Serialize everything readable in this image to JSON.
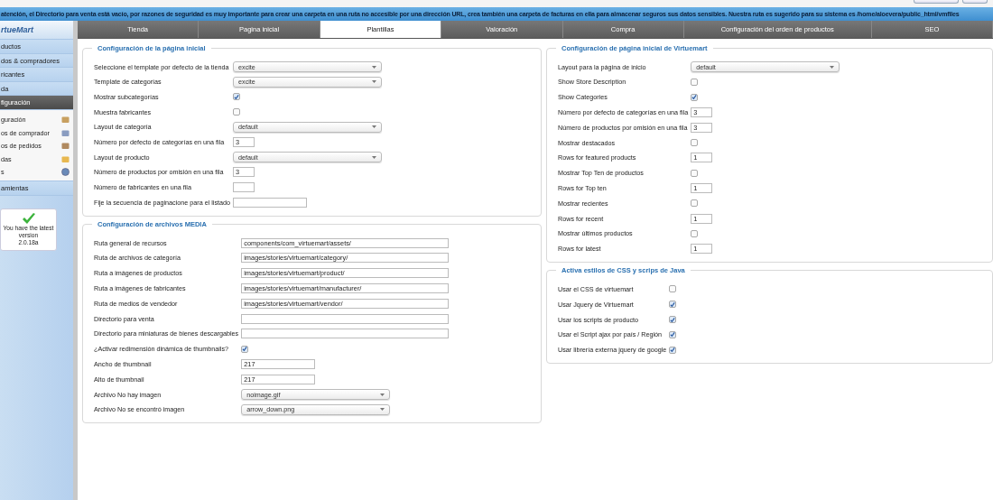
{
  "notice": "atención, el Directorio para venta está vacío, por razones de seguridad es muy importante para crear una carpeta en una ruta no accesible por una dirección URL, crea también una carpeta de facturas en ella para almacenar seguros sus datos sensibles. Nuestra ruta es sugerido para su sistema es /home/aloevera/public_html/vmfiles",
  "sidebar": {
    "logo": "rtueMart",
    "items": [
      {
        "label": "ductos",
        "selected": false
      },
      {
        "label": "dos & compradores",
        "selected": false
      },
      {
        "label": "ricantes",
        "selected": false
      },
      {
        "label": "da",
        "selected": false
      },
      {
        "label": "figuración",
        "selected": true,
        "children": [
          {
            "label": "guración"
          },
          {
            "label": "os de comprador"
          },
          {
            "label": "os de pedidos"
          },
          {
            "label": "das"
          },
          {
            "label": "s"
          }
        ]
      },
      {
        "label": "amientas",
        "selected": false
      }
    ],
    "version": {
      "message": "You have the latest version",
      "number": "2.0.18a"
    }
  },
  "tabs": [
    {
      "label": "Tienda",
      "selected": false
    },
    {
      "label": "Pagina inicial",
      "selected": false
    },
    {
      "label": "Plantillas",
      "selected": true
    },
    {
      "label": "Valoración",
      "selected": false
    },
    {
      "label": "Compra",
      "selected": false
    },
    {
      "label": "Configuración del orden de productos",
      "selected": false
    },
    {
      "label": "SEO",
      "selected": false
    }
  ],
  "columns": [
    [
      {
        "title": "Configuración de la página inicial",
        "fields": [
          {
            "label": "Seleccione el template por defecto de la tienda",
            "kind": "select",
            "value": "excite"
          },
          {
            "label": "Template de categorías",
            "kind": "select",
            "value": "excite"
          },
          {
            "label": "Mostrar subcategorías",
            "kind": "checkbox",
            "checked": true
          },
          {
            "label": "Muestra fabricantes",
            "kind": "checkbox",
            "checked": false
          },
          {
            "label": "Layout de categoría",
            "kind": "select",
            "value": "default"
          },
          {
            "label": "Número por defecto de categorías en una fila",
            "kind": "number",
            "value": "3"
          },
          {
            "label": "Layout de producto",
            "kind": "select",
            "value": "default"
          },
          {
            "label": "Número de productos por omisión en una fila",
            "kind": "number",
            "value": "3"
          },
          {
            "label": "Número de fabricantes en una fila",
            "kind": "number"
          },
          {
            "label": "Fije la secuencia de paginacione para el listado",
            "kind": "text"
          }
        ]
      },
      {
        "title": "Configuración de archivos MEDIA",
        "fields": [
          {
            "label": "Ruta general de recursos",
            "kind": "path",
            "value": "components/com_virtuemart/assets/"
          },
          {
            "label": "Ruta de archivos de categoría",
            "kind": "path",
            "value": "images/stories/virtuemart/category/"
          },
          {
            "label": "Ruta a imágenes de productos",
            "kind": "path",
            "value": "images/stories/virtuemart/product/"
          },
          {
            "label": "Ruta a imágenes de fabricantes",
            "kind": "path",
            "value": "images/stories/virtuemart/manufacturer/"
          },
          {
            "label": "Ruta de medios de vendedor",
            "kind": "path",
            "value": "images/stories/virtuemart/vendor/"
          },
          {
            "label": "Directorio para venta",
            "kind": "path"
          },
          {
            "label": "Directorio para miniaturas de bienes descargables",
            "kind": "path"
          },
          {
            "label": "¿Activar redimensión dinámica de thumbnails?",
            "kind": "checkbox",
            "checked": true
          },
          {
            "label": "Ancho de thumbnail",
            "kind": "text",
            "value": "217"
          },
          {
            "label": "Alto de thumbnail",
            "kind": "text",
            "value": "217"
          },
          {
            "label": "Archivo No hay imagen",
            "kind": "select",
            "value": "noimage.gif"
          },
          {
            "label": "Archivo No se encontró imagen",
            "kind": "select",
            "value": "arrow_down.png"
          }
        ]
      }
    ],
    [
      {
        "title": "Configuración de página inicial de Virtuemart",
        "fields": [
          {
            "label": "Layout para la página de inicio",
            "kind": "select",
            "value": "default"
          },
          {
            "label": "Show Store Description",
            "kind": "checkbox",
            "checked": false
          },
          {
            "label": "Show Categories",
            "kind": "checkbox",
            "checked": true
          },
          {
            "label": "Número por defecto de categorías en una fila",
            "kind": "number",
            "value": "3"
          },
          {
            "label": "Número de productos por omisión en una fila",
            "kind": "number",
            "value": "3"
          },
          {
            "label": "Mostrar destacados",
            "kind": "checkbox",
            "checked": false
          },
          {
            "label": "Rows for featured products",
            "kind": "number",
            "value": "1"
          },
          {
            "label": "Mostrar Top Ten de productos",
            "kind": "checkbox",
            "checked": false
          },
          {
            "label": "Rows for Top ten",
            "kind": "number",
            "value": "1"
          },
          {
            "label": "Mostrar recientes",
            "kind": "checkbox",
            "checked": false
          },
          {
            "label": "Rows for recent",
            "kind": "number",
            "value": "1"
          },
          {
            "label": "Mostrar últimos productos",
            "kind": "checkbox",
            "checked": false
          },
          {
            "label": "Rows for latest",
            "kind": "number",
            "value": "1"
          }
        ]
      },
      {
        "title": "Activa estilos de CSS y scrips de Java",
        "fields": [
          {
            "label": "Usar el CSS de virtuemart",
            "kind": "checkbox",
            "checked": false
          },
          {
            "label": "Usar Jquery de Virtuemart",
            "kind": "checkbox",
            "checked": true
          },
          {
            "label": "Usar los scripts de producto",
            "kind": "checkbox",
            "checked": true
          },
          {
            "label": "Usar el Script ajax por país / Región",
            "kind": "checkbox",
            "checked": true
          },
          {
            "label": "Usar librería externa jquery de google",
            "kind": "checkbox",
            "checked": true
          }
        ]
      }
    ]
  ]
}
